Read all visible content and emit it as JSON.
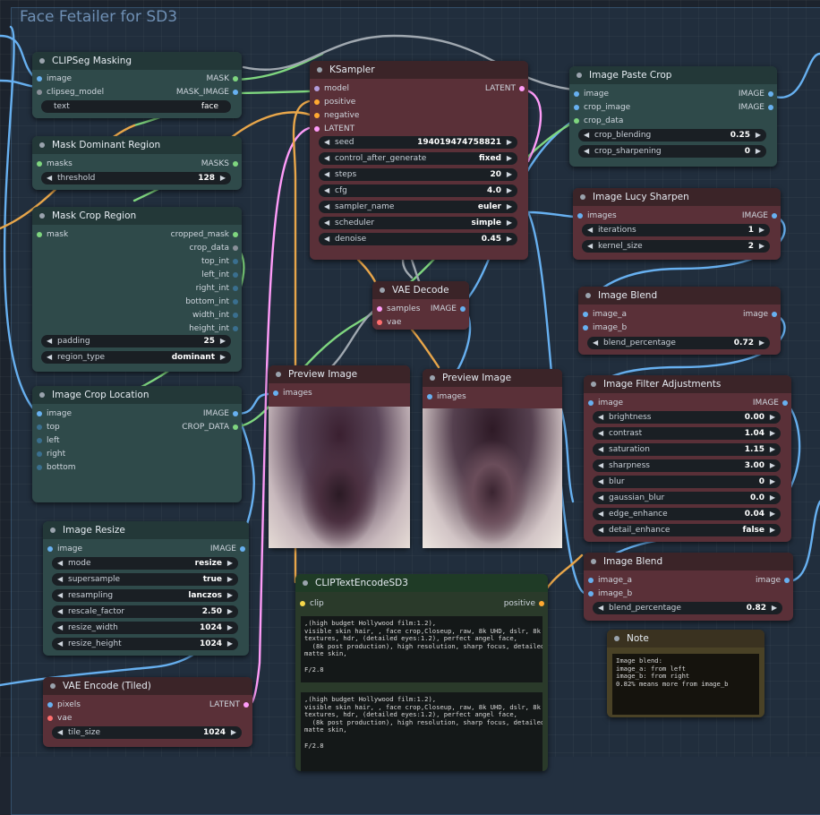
{
  "group_title": "Face Fetailer for SD3",
  "colors": {
    "float": "#e8a64a",
    "image": "#67b0f0",
    "mask": "#7fd67f",
    "latent": "#ff9cf9",
    "model": "#b39ddb",
    "clip": "#f5d74a",
    "vae": "#ff6e6e",
    "conditioning": "#ffa931"
  },
  "clipseg": {
    "title": "CLIPSeg Masking",
    "in_image": "image",
    "in_model": "clipseg_model",
    "out_mask": "MASK",
    "out_mask_image": "MASK_IMAGE",
    "text_label": "text",
    "text_value": "face"
  },
  "mask_dominant": {
    "title": "Mask Dominant Region",
    "in_masks": "masks",
    "out_masks": "MASKS",
    "thr_label": "threshold",
    "thr_value": "128"
  },
  "mask_crop": {
    "title": "Mask Crop Region",
    "in_mask": "mask",
    "outputs": [
      "cropped_mask",
      "crop_data",
      "top_int",
      "left_int",
      "right_int",
      "bottom_int",
      "width_int",
      "height_int"
    ],
    "padding_label": "padding",
    "padding_value": "25",
    "region_label": "region_type",
    "region_value": "dominant"
  },
  "crop_loc": {
    "title": "Image Crop Location",
    "inputs": [
      "image",
      "top",
      "left",
      "right",
      "bottom"
    ],
    "out_image": "IMAGE",
    "out_crop": "CROP_DATA"
  },
  "resize": {
    "title": "Image Resize",
    "in_image": "image",
    "out_image": "IMAGE",
    "widgets": [
      {
        "label": "mode",
        "value": "resize"
      },
      {
        "label": "supersample",
        "value": "true"
      },
      {
        "label": "resampling",
        "value": "lanczos"
      },
      {
        "label": "rescale_factor",
        "value": "2.50"
      },
      {
        "label": "resize_width",
        "value": "1024"
      },
      {
        "label": "resize_height",
        "value": "1024"
      }
    ]
  },
  "vae_enc": {
    "title": "VAE Encode (Tiled)",
    "in_pixels": "pixels",
    "in_vae": "vae",
    "out_latent": "LATENT",
    "tile_label": "tile_size",
    "tile_value": "1024"
  },
  "ksampler": {
    "title": "KSampler",
    "inputs": [
      "model",
      "positive",
      "negative",
      "LATENT"
    ],
    "out_latent": "LATENT",
    "widgets": [
      {
        "label": "seed",
        "value": "194019474758821"
      },
      {
        "label": "control_after_generate",
        "value": "fixed"
      },
      {
        "label": "steps",
        "value": "20"
      },
      {
        "label": "cfg",
        "value": "4.0"
      },
      {
        "label": "sampler_name",
        "value": "euler"
      },
      {
        "label": "scheduler",
        "value": "simple"
      },
      {
        "label": "denoise",
        "value": "0.45"
      }
    ]
  },
  "vae_dec": {
    "title": "VAE Decode",
    "in_samples": "samples",
    "in_vae": "vae",
    "out_image": "IMAGE"
  },
  "preview1": {
    "title": "Preview Image",
    "in_images": "images"
  },
  "preview2": {
    "title": "Preview Image",
    "in_images": "images"
  },
  "paste": {
    "title": "Image Paste Crop",
    "inputs": [
      "image",
      "crop_image",
      "crop_data"
    ],
    "out1": "IMAGE",
    "out2": "IMAGE",
    "w1_label": "crop_blending",
    "w1_value": "0.25",
    "w2_label": "crop_sharpening",
    "w2_value": "0"
  },
  "lucy": {
    "title": "Image Lucy Sharpen",
    "in_images": "images",
    "out_image": "IMAGE",
    "w1_label": "iterations",
    "w1_value": "1",
    "w2_label": "kernel_size",
    "w2_value": "2"
  },
  "blend1": {
    "title": "Image Blend",
    "in_a": "image_a",
    "in_b": "image_b",
    "out": "image",
    "w_label": "blend_percentage",
    "w_value": "0.72"
  },
  "filter": {
    "title": "Image Filter Adjustments",
    "in_image": "image",
    "out_image": "IMAGE",
    "widgets": [
      {
        "label": "brightness",
        "value": "0.00"
      },
      {
        "label": "contrast",
        "value": "1.04"
      },
      {
        "label": "saturation",
        "value": "1.15"
      },
      {
        "label": "sharpness",
        "value": "3.00"
      },
      {
        "label": "blur",
        "value": "0"
      },
      {
        "label": "gaussian_blur",
        "value": "0.0"
      },
      {
        "label": "edge_enhance",
        "value": "0.04"
      },
      {
        "label": "detail_enhance",
        "value": "false"
      }
    ]
  },
  "blend2": {
    "title": "Image Blend",
    "in_a": "image_a",
    "in_b": "image_b",
    "out": "image",
    "w_label": "blend_percentage",
    "w_value": "0.82"
  },
  "clipenc": {
    "title": "CLIPTextEncodeSD3",
    "in_clip": "clip",
    "out_positive": "positive",
    "text1": ",(high budget Hollywood film:1.2),\nvisible skin hair, , face crop,Closeup, raw, 8k UHD, dslr, 8k\ntextures, hdr, (detailed eyes:1.2), perfect angel face,\n  (8k post production), high resolution, sharp focus, detailed,\nmatte skin,\n\nF/2.8",
    "text2": ",(high budget Hollywood film:1.2),\nvisible skin hair, , face crop,Closeup, raw, 8k UHD, dslr, 8k\ntextures, hdr, (detailed eyes:1.2), perfect angel face,\n  (8k post production), high resolution, sharp focus, detailed,\nmatte skin,\n\nF/2.8"
  },
  "note": {
    "title": "Note",
    "text": "Image blend:\nimage_a: from left\nimage_b: from right\n0.82% means more from image_b"
  }
}
